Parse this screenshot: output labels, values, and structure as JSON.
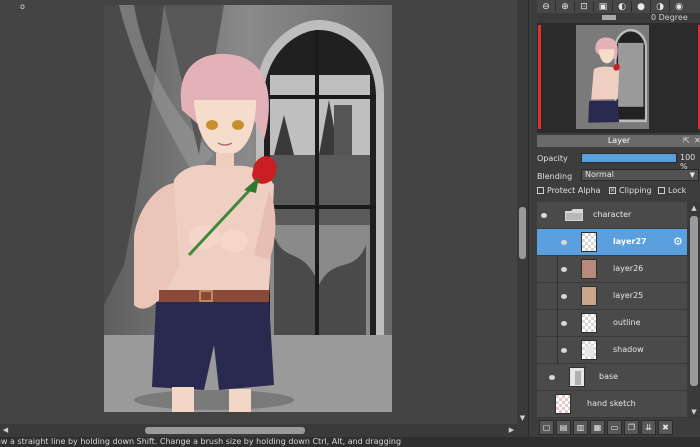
{
  "canvas": {
    "origin_marker": "o"
  },
  "status_bar": {
    "hint": "aw a straight line by holding down Shift. Change a brush size by holding down Ctrl, Alt, and dragging"
  },
  "navigator": {
    "toolbar_icons": [
      "zoom-out-icon",
      "zoom-in-icon",
      "zoom-fit-icon",
      "zoom-actual-icon",
      "rotate-left-icon",
      "rotate-reset-icon",
      "rotate-right-icon",
      "flip-horizontal-icon",
      "flip-vertical-icon"
    ],
    "degree_label": "0 Degree"
  },
  "layer_panel": {
    "title": "Layer",
    "opacity_label": "Opacity",
    "opacity_value": "100 %",
    "opacity_fraction": 1.0,
    "blending_label": "Blending",
    "blending_value": "Normal",
    "protect_alpha_label": "Protect Alpha",
    "clipping_label": "Clipping",
    "lock_label": "Lock",
    "clipping_checked": "×",
    "layers": [
      {
        "name": "character",
        "kind": "folder"
      },
      {
        "name": "layer27",
        "kind": "layer",
        "selected": true
      },
      {
        "name": "layer26",
        "kind": "layer"
      },
      {
        "name": "layer25",
        "kind": "layer"
      },
      {
        "name": "outline",
        "kind": "layer"
      },
      {
        "name": "shadow",
        "kind": "layer"
      },
      {
        "name": "base",
        "kind": "layer"
      },
      {
        "name": "hand sketch",
        "kind": "layer"
      }
    ],
    "toolbar_icons": [
      "new-layer-icon",
      "new-layer-8bit-icon",
      "new-layer-1bit-icon",
      "new-halftone-layer-icon",
      "new-folder-icon",
      "duplicate-layer-icon",
      "merge-down-icon",
      "delete-layer-icon"
    ]
  },
  "colors": {
    "accent": "#5a9fde",
    "navigator_frame": "#e03030"
  }
}
